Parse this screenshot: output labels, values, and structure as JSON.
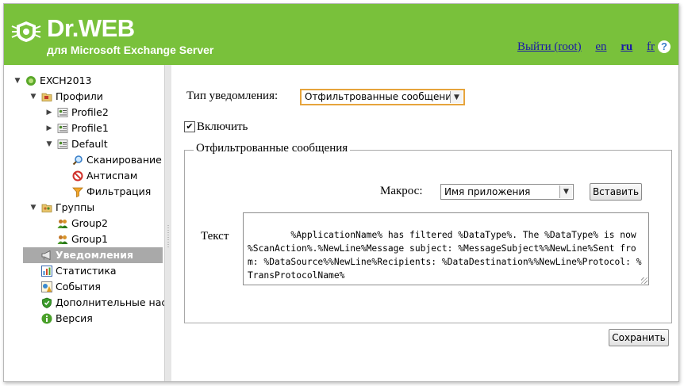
{
  "header": {
    "brand": "Dr.WEB",
    "subtitle": "для Microsoft Exchange Server",
    "logout": "Выйти (root)",
    "langs": [
      "en",
      "ru",
      "fr"
    ],
    "active_lang": "ru",
    "help": "?",
    "bg_color": "#79c13b"
  },
  "sidebar": {
    "items": [
      {
        "label": "EXCH2013",
        "icon": "server-icon",
        "arrow": "▼"
      },
      {
        "label": "Профили",
        "icon": "folder-icon",
        "arrow": "▼"
      },
      {
        "label": "Profile2",
        "icon": "profile-icon",
        "arrow": "▶"
      },
      {
        "label": "Profile1",
        "icon": "profile-icon",
        "arrow": "▶"
      },
      {
        "label": "Default",
        "icon": "profile-icon",
        "arrow": "▼"
      },
      {
        "label": "Сканирование",
        "icon": "scan-icon",
        "arrow": ""
      },
      {
        "label": "Антиспам",
        "icon": "antispam-icon",
        "arrow": ""
      },
      {
        "label": "Фильтрация",
        "icon": "filter-icon",
        "arrow": ""
      },
      {
        "label": "Группы",
        "icon": "groups-folder-icon",
        "arrow": "▼"
      },
      {
        "label": "Group2",
        "icon": "group-icon",
        "arrow": ""
      },
      {
        "label": "Group1",
        "icon": "group-icon",
        "arrow": ""
      },
      {
        "label": "Уведомления",
        "icon": "megaphone-icon",
        "arrow": ""
      },
      {
        "label": "Статистика",
        "icon": "statistics-icon",
        "arrow": ""
      },
      {
        "label": "События",
        "icon": "events-icon",
        "arrow": ""
      },
      {
        "label": "Дополнительные наст",
        "icon": "shield-icon",
        "arrow": ""
      },
      {
        "label": "Версия",
        "icon": "info-icon",
        "arrow": ""
      }
    ],
    "selected_label": "Уведомления"
  },
  "main": {
    "notification_type_label": "Тип уведомления:",
    "notification_type_value": "Отфильтрованные сообщения",
    "enable_label": "Включить",
    "enable_checked": "✔",
    "fieldset_legend": "Отфильтрованные сообщения",
    "macro_label": "Макрос:",
    "macro_value": "Имя приложения",
    "insert_button": "Вставить",
    "text_label": "Текст",
    "text_value": "%ApplicationName% has filtered %DataType%. The %DataType% is now %ScanAction%.%NewLine%Message subject: %MessageSubject%%NewLine%Sent from: %DataSource%%NewLine%Recipients: %DataDestination%%NewLine%Protocol: %TransProtocolName%",
    "save_button": "Сохранить"
  }
}
